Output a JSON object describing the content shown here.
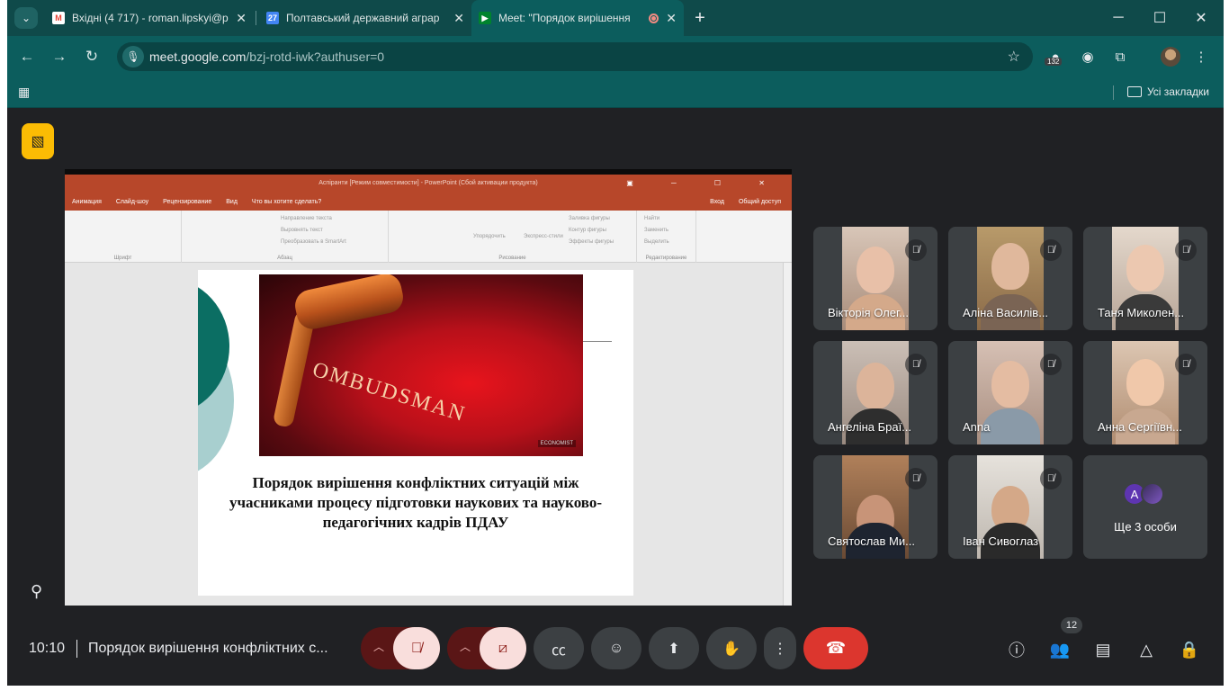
{
  "browser": {
    "tabs": [
      {
        "title": "Вхідні (4 717) - roman.lipskyi@p",
        "icon": "gmail-icon"
      },
      {
        "title": "Полтавський державний аграр",
        "icon": "calendar-icon",
        "icon_text": "27"
      },
      {
        "title": "Meet: \"Порядок вирішення",
        "icon": "meet-icon"
      }
    ],
    "url_host": "meet.google.com",
    "url_path": "/bzj-rotd-iwk?authuser=0",
    "extension_badge": "132",
    "all_bookmarks": "Усі закладки"
  },
  "presentation": {
    "ppt_title": "Аспіранти [Режим совместимости] - PowerPoint (Сбой активации продукта)",
    "ppt_menu": [
      "Анимация",
      "Слайд-шоу",
      "Рецензирование",
      "Вид",
      "Что вы хотите сделать?"
    ],
    "ppt_menu_right": [
      "Вход",
      "Общий доступ"
    ],
    "ribbon_groups": [
      "Шрифт",
      "Абзац",
      "Рисование",
      "Редактирование"
    ],
    "ribbon_items": [
      "Направление текста",
      "Выровнять текст",
      "Преобразовать в SmartArt",
      "Упорядочить",
      "Экспресс-стили",
      "Заливка фигуры",
      "Контур фигуры",
      "Эффекты фигуры",
      "Найти",
      "Заменить",
      "Выделить"
    ],
    "photo_text": "OMBUDSMAN",
    "photo_credit": "ECONOMIST",
    "slide_caption": "Порядок вирішення конфліктних ситуацій між учасниками процесу підготовки наукових та науково-педагогічних кадрів ПДАУ"
  },
  "participants": [
    {
      "name": "Вікторія Олег..."
    },
    {
      "name": "Аліна Василів..."
    },
    {
      "name": "Таня Миколен..."
    },
    {
      "name": "Ангеліна Брaї..."
    },
    {
      "name": "Anna"
    },
    {
      "name": "Анна Сергіївн..."
    },
    {
      "name": "Святослав Ми..."
    },
    {
      "name": "Іван Сивоглаз"
    }
  ],
  "more_tile": {
    "avatar_letter": "A",
    "label": "Ще 3 особи"
  },
  "meeting": {
    "time": "10:10",
    "title": "Порядок вирішення конфліктних с...",
    "participant_count": "12"
  },
  "colors": {
    "accent_teal": "#0c5d5d",
    "meet_bg": "#202124",
    "end_call": "#dc362e",
    "warning": "#fbbc04"
  }
}
